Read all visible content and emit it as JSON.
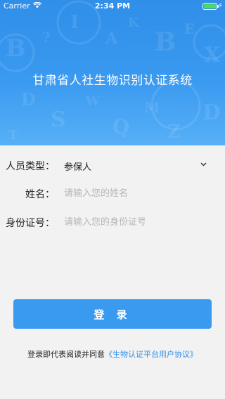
{
  "status_bar": {
    "carrier": "Carrier",
    "time": "2:34 PM",
    "wifi_icon": "wifi-icon",
    "battery_icon": "battery-charging-icon",
    "battery_color": "#4cd964"
  },
  "header": {
    "title": "甘肃省人社生物识别认证系统",
    "background_color": "#3a9af0"
  },
  "form": {
    "type_label": "人员类型：",
    "type_value": "参保人",
    "type_dropdown_icon": "chevron-down-icon",
    "name_label": "姓名：",
    "name_placeholder": "请输入您的姓名",
    "id_label": "身份证号：",
    "id_placeholder": "请输入您的身份证号"
  },
  "login_button": {
    "label": "登 录",
    "color": "#3a9af0"
  },
  "agreement": {
    "prefix": "登录即代表阅读并同意",
    "link": "《生物认证平台用户协议》",
    "link_color": "#2f8fe9"
  }
}
